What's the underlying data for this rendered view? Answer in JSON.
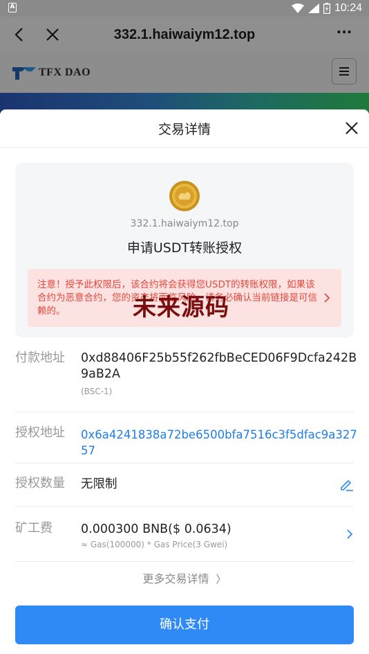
{
  "status_bar": {
    "time": "10:24",
    "app_icon_letter": "A"
  },
  "browser": {
    "url": "332.1.haiwaiym12.top",
    "more": "···"
  },
  "site": {
    "logo_text": "TFX DAO",
    "logo_sub": "T F X   D A O"
  },
  "sheet": {
    "title": "交易详情",
    "domain": "332.1.haiwaiym12.top",
    "request": "申请USDT转账授权",
    "warning": "注意！授予此权限后，该合约将会获得您USDT的转账权限，如果该合约为恶意合约，您的资产将面临风险，请务必确认当前链接是可信赖的。",
    "watermark": "未来源码",
    "payer": {
      "label": "付款地址",
      "address": "0xd88406F25b55f262fbBeCED06F9Dcfa242B9aB2A",
      "network": "(BSC-1)"
    },
    "spender": {
      "label": "授权地址",
      "address": "0x6a4241838a72be6500bfa7516c3f5dfac9a32757"
    },
    "amount": {
      "label": "授权数量",
      "value": "无限制"
    },
    "fee": {
      "label": "矿工费",
      "value": "0.000300 BNB($ 0.0634)",
      "detail": "≈ Gas(100000) * Gas Price(3 Gwei)"
    },
    "more_details": "更多交易详情",
    "confirm_label": "确认支付"
  },
  "colors": {
    "accent": "#2f8af5",
    "link": "#1e7ee6",
    "warning_bg": "#fde2e2",
    "warning_text": "#e4483c"
  }
}
